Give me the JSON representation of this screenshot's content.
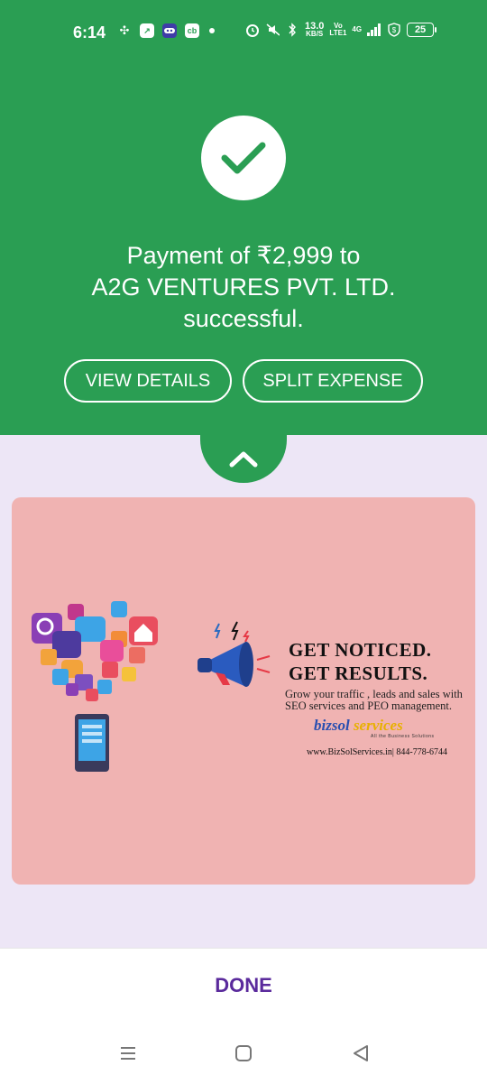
{
  "theme": {
    "green": "#2a9e53",
    "purple": "#5a2a9c",
    "sheet_bg": "#ede6f6",
    "ad_bg": "#f0b3b2"
  },
  "status_bar": {
    "time": "6:14",
    "net_speed_value": "13.0",
    "net_speed_unit": "KB/S",
    "volte_top": "Vo",
    "volte_bottom": "LTE1",
    "network": "4G",
    "battery": "25",
    "icons": [
      "fan-icon",
      "app-icon",
      "game-icon",
      "cb-icon",
      "alarm-icon",
      "mute-icon",
      "bluetooth-icon",
      "signal-icon",
      "data-saver-icon"
    ]
  },
  "payment": {
    "message_line1": "Payment of ₹2,999 to",
    "message_line2": "A2G VENTURES PVT. LTD.",
    "message_line3": "successful."
  },
  "actions": {
    "view_details": "VIEW DETAILS",
    "split_expense": "SPLIT EXPENSE"
  },
  "ad": {
    "headline_line1": "GET NOTICED.",
    "headline_line2": "GET RESULTS.",
    "subtext": "Grow your traffic , leads and sales with SEO services and PEO management.",
    "brand_part1": "bizsol",
    "brand_part2": "services",
    "brand_tagline": "All the Business Solutions",
    "contact": "www.BizSolServices.in| 844-778-6744"
  },
  "footer": {
    "done_label": "DONE"
  },
  "nav": {
    "icons": [
      "recents-icon",
      "home-icon",
      "back-icon"
    ]
  }
}
